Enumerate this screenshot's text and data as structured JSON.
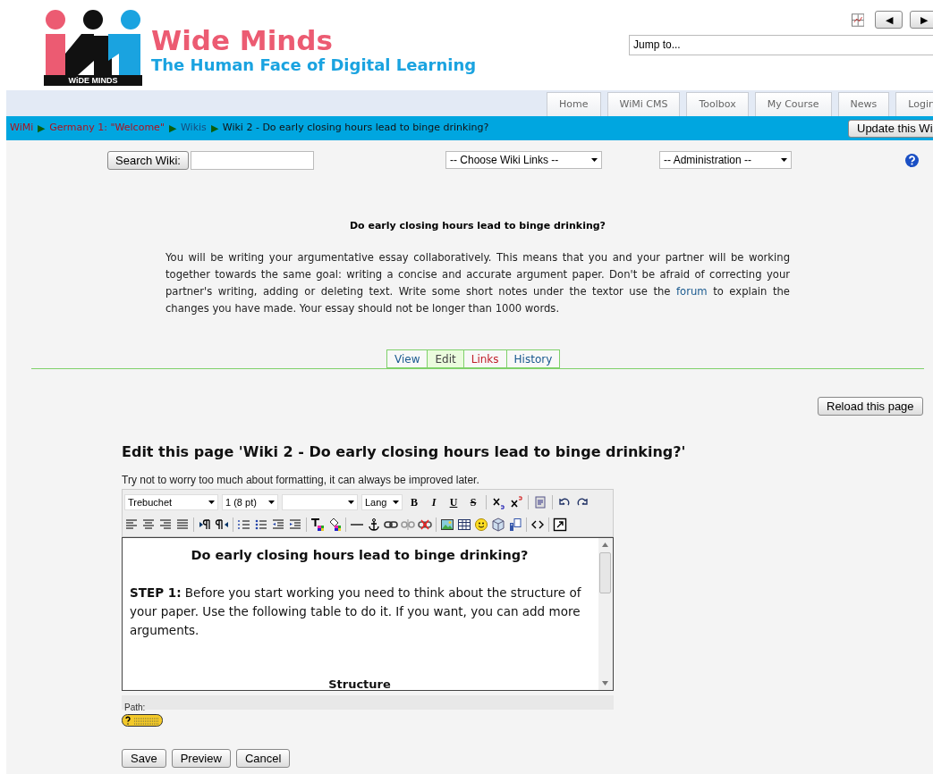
{
  "header": {
    "title": "Wide Minds",
    "subtitle": "The Human Face of Digital Learning",
    "logo_text": "WiDE MINDS",
    "nav_prev": "◀",
    "nav_next": "▶",
    "jump": {
      "value": "Jump to..."
    }
  },
  "nav_tabs": [
    "Home",
    "WiMi CMS",
    "Toolbox",
    "My Course",
    "News",
    "Login"
  ],
  "breadcrumb": [
    {
      "label": "WiMi",
      "kind": "visited_link"
    },
    {
      "label": "Germany 1: \"Welcome\"",
      "kind": "visited_link"
    },
    {
      "label": "Wikis",
      "kind": "link"
    },
    {
      "label": "Wiki 2 - Do early closing hours lead to binge drinking?",
      "kind": "current"
    }
  ],
  "breadcrumb_separator": "▶",
  "update_button": "Update this Wi",
  "search_button": "Search Wiki:",
  "wiki_links_select": "-- Choose Wiki Links --",
  "admin_select": "-- Administration --",
  "intro": {
    "title": "Do early closing hours lead to binge drinking?",
    "text_before": "You will be writing your argumentative essay collaboratively. This means that you and your partner will be working together towards the same goal: writing a concise and accurate argument paper. Don't be afraid of correcting your partner's writing, adding or deleting text. Write some short notes under the textor use the",
    "link": "forum",
    "text_after": "to explain the changes you have made. Your essay should not be longer than 1000 words."
  },
  "wiki_tabs": [
    {
      "label": "View",
      "selected": false,
      "visited": false
    },
    {
      "label": "Edit",
      "selected": true,
      "visited": false
    },
    {
      "label": "Links",
      "selected": false,
      "visited": true
    },
    {
      "label": "History",
      "selected": false,
      "visited": false
    }
  ],
  "reload_button": "Reload this page",
  "edit_title": "Edit this page 'Wiki 2 - Do early closing hours lead to binge drinking?'",
  "edit_hint": "Try not to worry too much about formatting, it can always be improved later.",
  "toolbar_selects": [
    {
      "kind": "font",
      "value": "Trebuchet"
    },
    {
      "kind": "size",
      "value": "1 (8 pt)"
    },
    {
      "kind": "format"
    },
    {
      "kind": "language",
      "value": "Lang"
    }
  ],
  "toolbar_glyphs": [
    "B",
    "I",
    "U",
    "S"
  ],
  "editor": {
    "heading": "Do early closing hours lead to binge drinking?",
    "step": "**STEP 1:** Before you start working you need to think about the structure of your paper. Use the following table to do it. If you want, you can add more arguments.",
    "structure": "Structure"
  },
  "path_label": "Path:",
  "buttons": [
    "Save",
    "Preview",
    "Cancel"
  ]
}
